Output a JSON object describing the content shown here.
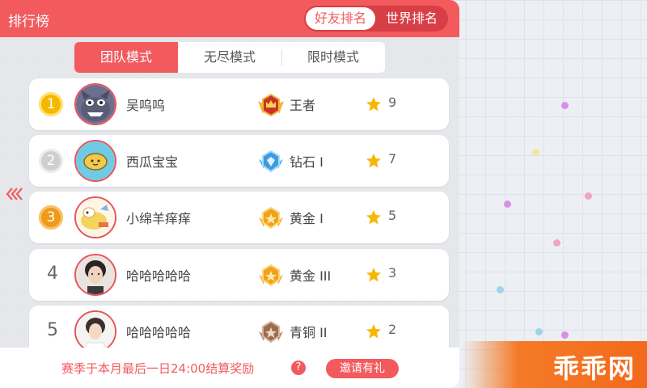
{
  "header": {
    "title": "排行榜",
    "toggle": [
      {
        "label": "好友排名",
        "active": true
      },
      {
        "label": "世界排名",
        "active": false
      }
    ]
  },
  "tabs": [
    {
      "label": "团队模式",
      "active": true
    },
    {
      "label": "无尽模式",
      "active": false
    },
    {
      "label": "限时模式",
      "active": false
    }
  ],
  "rows": [
    {
      "rank": "1",
      "name": "吴呜呜",
      "tier": "王者",
      "score": "9"
    },
    {
      "rank": "2",
      "name": "西瓜宝宝",
      "tier": "钻石 I",
      "score": "7"
    },
    {
      "rank": "3",
      "name": "小绵羊痒痒",
      "tier": "黄金 I",
      "score": "5"
    },
    {
      "rank": "4",
      "name": "哈哈哈哈哈",
      "tier": "黄金 III",
      "score": "3"
    },
    {
      "rank": "5",
      "name": "哈哈哈哈哈",
      "tier": "青铜 II",
      "score": "2"
    }
  ],
  "footer": {
    "season_text": "赛季于本月最后一日24:00结算奖励",
    "help_glyph": "?",
    "invite_label": "邀请有礼"
  },
  "watermark": "乖乖网",
  "colors": {
    "accent": "#f25a5e",
    "gold": "#f5b800",
    "silver": "#cccccc",
    "bronze": "#f09a1a"
  }
}
